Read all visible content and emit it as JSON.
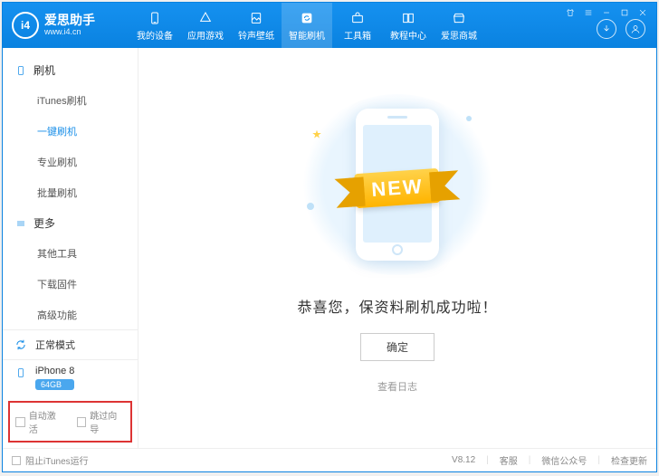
{
  "brand": {
    "title": "爱思助手",
    "subtitle": "www.i4.cn",
    "logo_text": "i4"
  },
  "nav": {
    "tabs": [
      {
        "label": "我的设备"
      },
      {
        "label": "应用游戏"
      },
      {
        "label": "铃声壁纸"
      },
      {
        "label": "智能刷机"
      },
      {
        "label": "工具箱"
      },
      {
        "label": "教程中心"
      },
      {
        "label": "爱思商城"
      }
    ],
    "active_index": 3
  },
  "sidebar": {
    "groups": [
      {
        "title": "刷机",
        "items": [
          "iTunes刷机",
          "一键刷机",
          "专业刷机",
          "批量刷机"
        ],
        "active_index": 1
      },
      {
        "title": "更多",
        "items": [
          "其他工具",
          "下载固件",
          "高级功能"
        ],
        "active_index": -1
      }
    ],
    "mode": "正常模式",
    "device": {
      "name": "iPhone 8",
      "storage": "64GB"
    },
    "checks": {
      "auto_activate": "自动激活",
      "skip_guide": "跳过向导"
    }
  },
  "main": {
    "ribbon": "NEW",
    "message": "恭喜您，保资料刷机成功啦！",
    "ok": "确定",
    "log": "查看日志"
  },
  "footer": {
    "block_itunes": "阻止iTunes运行",
    "version": "V8.12",
    "links": [
      "客服",
      "微信公众号",
      "检查更新"
    ]
  }
}
